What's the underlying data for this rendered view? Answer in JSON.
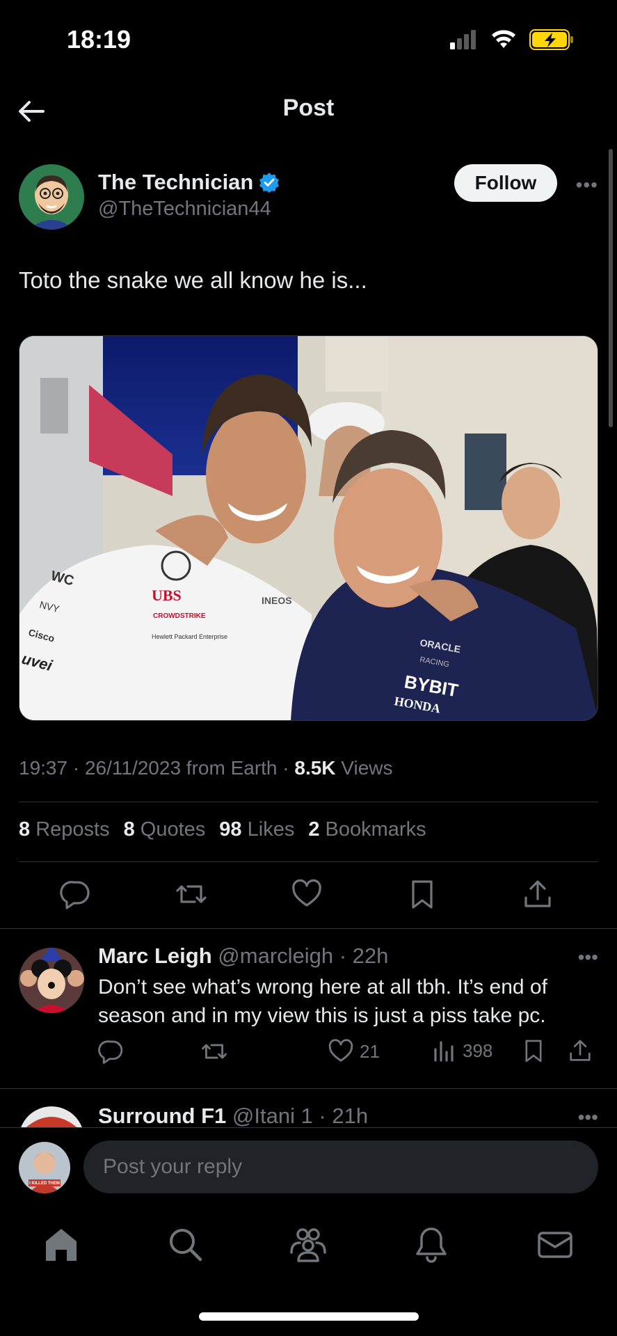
{
  "status_bar": {
    "time": "18:19"
  },
  "nav": {
    "title": "Post"
  },
  "post": {
    "author_name": "The Technician",
    "author_handle": "@TheTechnician44",
    "follow_label": "Follow",
    "text": "Toto the snake we all know he is...",
    "timestamp": "19:37 · 26/11/2023 from Earth · ",
    "views_count": "8.5K",
    "views_label": " Views",
    "stats": [
      {
        "count": "8",
        "label": "Reposts"
      },
      {
        "count": "8",
        "label": "Quotes"
      },
      {
        "count": "98",
        "label": "Likes"
      },
      {
        "count": "2",
        "label": "Bookmarks"
      }
    ],
    "media_text": {
      "sponsor_left": [
        "WC",
        "NVY",
        "Cisco",
        "uvei"
      ],
      "shirt_1": "UBS",
      "shirt_2": "CROWDSTRIKE",
      "shirt_3": "Hewlett Packard Enterprise",
      "shirt_4": "INEOS",
      "rb_1": "ORACLE",
      "rb_2": "RACING",
      "rb_3": "BYBIT",
      "rb_4": "HONDA"
    }
  },
  "replies": [
    {
      "name": "Marc Leigh",
      "handle": "@marcleigh · 22h",
      "text": "Don’t see what’s wrong here at all tbh.  It’s end of season and in my view this is just a piss take pc.",
      "likes": "21",
      "views": "398"
    },
    {
      "name": "Surround F1",
      "handle": "@Itani 1 · 21h"
    }
  ],
  "compose": {
    "placeholder": "Post your reply",
    "avatar_caption": "I KILLED THEM"
  },
  "colors": {
    "verified": "#1d9bf0",
    "battery": "#ffd60a",
    "muted": "#71767b"
  }
}
